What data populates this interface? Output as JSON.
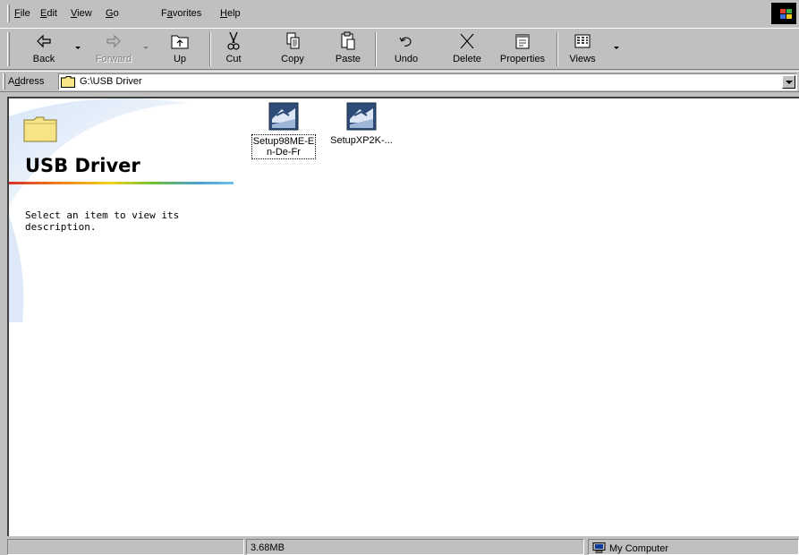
{
  "menubar": {
    "items": [
      {
        "pre": "",
        "key": "F",
        "post": "ile"
      },
      {
        "pre": "",
        "key": "E",
        "post": "dit"
      },
      {
        "pre": "",
        "key": "V",
        "post": "iew"
      },
      {
        "pre": "",
        "key": "G",
        "post": "o"
      },
      {
        "pre": "F",
        "key": "a",
        "post": "vorites"
      },
      {
        "pre": "",
        "key": "H",
        "post": "elp"
      }
    ]
  },
  "toolbar": {
    "back": "Back",
    "forward": "Forward",
    "up": "Up",
    "cut": "Cut",
    "copy": "Copy",
    "paste": "Paste",
    "undo": "Undo",
    "delete": "Delete",
    "properties": "Properties",
    "views": "Views"
  },
  "address": {
    "label_pre": "A",
    "label_key": "d",
    "label_post": "dress",
    "value": "G:\\USB Driver"
  },
  "webview": {
    "folder_title": "USB Driver",
    "description": "Select an item to view its description."
  },
  "files": [
    {
      "name": "Setup98ME-E\nn-De-Fr",
      "icon": "installer-icon",
      "focused": true
    },
    {
      "name": "SetupXP2K-...",
      "icon": "installer-icon",
      "focused": false
    }
  ],
  "status": {
    "panel1": "",
    "size": "3.68MB",
    "zone": "My Computer"
  },
  "colors": {
    "face": "#c0c0c0",
    "window_bg": "#ffffff",
    "folder_yellow": "#f6e487"
  }
}
